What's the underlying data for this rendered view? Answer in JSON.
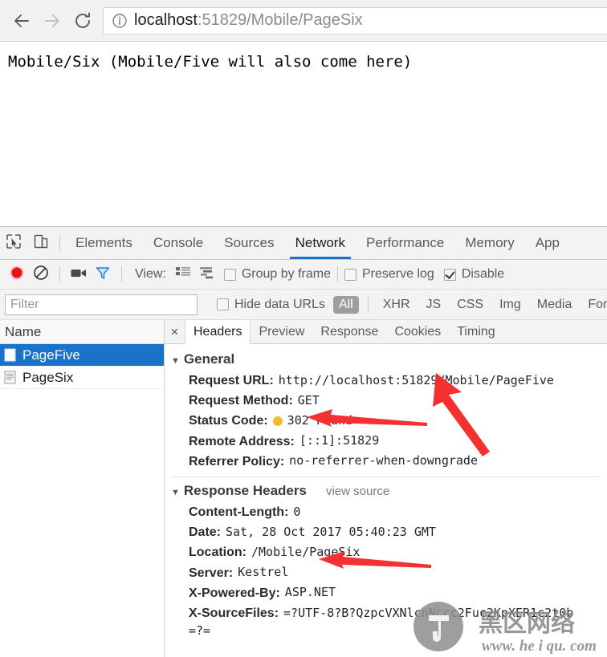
{
  "browser": {
    "back_icon": "arrow-left-icon",
    "forward_icon": "arrow-right-icon",
    "reload_icon": "reload-icon",
    "info_icon": "info-circle-icon",
    "url_host": "localhost",
    "url_rest": ":51829/Mobile/PageSix"
  },
  "page": {
    "body_text": "Mobile/Six (Mobile/Five will also come here)"
  },
  "devtools": {
    "inspect_icon": "inspect-cursor-icon",
    "device_icon": "device-toolbar-icon",
    "tabs": [
      {
        "label": "Elements",
        "active": false
      },
      {
        "label": "Console",
        "active": false
      },
      {
        "label": "Sources",
        "active": false
      },
      {
        "label": "Network",
        "active": true
      },
      {
        "label": "Performance",
        "active": false
      },
      {
        "label": "Memory",
        "active": false
      },
      {
        "label": "App",
        "active": false
      }
    ],
    "network_toolbar": {
      "record_icon": "record-circle-icon",
      "clear_icon": "clear-no-entry-icon",
      "camera_icon": "camera-icon",
      "filter_icon": "funnel-filter-icon",
      "view_label": "View:",
      "view_list_icon": "list-view-icon",
      "view_waterfall_icon": "waterfall-view-icon",
      "group_by_frame": {
        "label": "Group by frame",
        "checked": false
      },
      "preserve_log": {
        "label": "Preserve log",
        "checked": false
      },
      "disable_cache": {
        "label": "Disable",
        "checked": true
      }
    },
    "filter_row": {
      "filter_placeholder": "Filter",
      "filter_value": "",
      "hide_data_urls": {
        "label": "Hide data URLs",
        "checked": false
      },
      "types": [
        {
          "label": "All",
          "selected": true
        },
        {
          "label": "XHR",
          "selected": false
        },
        {
          "label": "JS",
          "selected": false
        },
        {
          "label": "CSS",
          "selected": false
        },
        {
          "label": "Img",
          "selected": false
        },
        {
          "label": "Media",
          "selected": false
        },
        {
          "label": "Font",
          "selected": false
        }
      ]
    },
    "request_list": {
      "column_header": "Name",
      "rows": [
        {
          "name": "PageFive",
          "selected": true,
          "icon": "document-icon"
        },
        {
          "name": "PageSix",
          "selected": false,
          "icon": "document-lines-icon"
        }
      ]
    },
    "detail": {
      "close_label": "×",
      "tabs": [
        {
          "label": "Headers",
          "active": true
        },
        {
          "label": "Preview",
          "active": false
        },
        {
          "label": "Response",
          "active": false
        },
        {
          "label": "Cookies",
          "active": false
        },
        {
          "label": "Timing",
          "active": false
        }
      ],
      "general": {
        "title": "General",
        "rows": [
          {
            "name": "Request URL:",
            "value": "http://localhost:51829/Mobile/PageFive"
          },
          {
            "name": "Request Method:",
            "value": "GET"
          },
          {
            "name": "Status Code:",
            "value": "302 Found",
            "dot_color": "#f0bc2c"
          },
          {
            "name": "Remote Address:",
            "value": "[::1]:51829"
          },
          {
            "name": "Referrer Policy:",
            "value": "no-referrer-when-downgrade"
          }
        ]
      },
      "response_headers": {
        "title": "Response Headers",
        "view_source": "view source",
        "rows": [
          {
            "name": "Content-Length:",
            "value": "0"
          },
          {
            "name": "Date:",
            "value": "Sat, 28 Oct 2017 05:40:23 GMT"
          },
          {
            "name": "Location:",
            "value": "/Mobile/PageSix"
          },
          {
            "name": "Server:",
            "value": "Kestrel"
          },
          {
            "name": "X-Powered-By:",
            "value": "ASP.NET"
          },
          {
            "name": "X-SourceFiles:",
            "value": "=?UTF-8?B?QzpcVXNlcnNccc2Fuc2KpXER1c2t0b"
          }
        ],
        "continuation": "=?="
      }
    }
  },
  "annotations": {
    "arrow_color": "#f43030",
    "arrow_url_target": "request-url",
    "arrow_status_target": "status-code",
    "arrow_location_target": "location-header"
  },
  "watermark": {
    "text_cn": "黑区网络",
    "text_url": "www.heiqu.com",
    "color": "#9a9a9a"
  }
}
